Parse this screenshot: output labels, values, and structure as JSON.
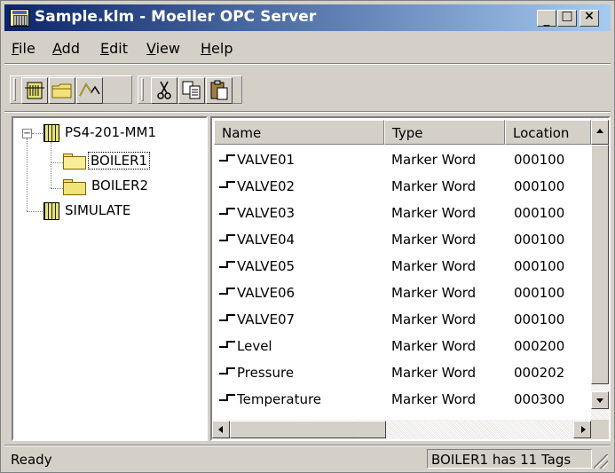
{
  "window": {
    "title": "Sample.klm - Moeller OPC Server",
    "controls": {
      "minimize": "_",
      "maximize": "□",
      "close": "×"
    }
  },
  "menu": [
    {
      "label": "File",
      "key": "F",
      "rest": "ile"
    },
    {
      "label": "Add",
      "key": "A",
      "rest": "dd"
    },
    {
      "label": "Edit",
      "key": "E",
      "rest": "dit"
    },
    {
      "label": "View",
      "key": "V",
      "rest": "iew"
    },
    {
      "label": "Help",
      "key": "H",
      "rest": "elp"
    }
  ],
  "toolbar": {
    "buttons": [
      "new-device-icon",
      "new-group-icon",
      "new-tag-icon",
      "cut-icon",
      "copy-icon",
      "paste-icon"
    ]
  },
  "tree": {
    "root": {
      "label": "PS4-201-MM1",
      "expanded": true
    },
    "groups": [
      {
        "label": "BOILER1",
        "selected": true
      },
      {
        "label": "BOILER2",
        "selected": false
      }
    ],
    "other": {
      "label": "SIMULATE"
    }
  },
  "list": {
    "columns": [
      "Name",
      "Type",
      "Location"
    ],
    "rows": [
      {
        "name": "VALVE01",
        "type": "Marker Word",
        "location": "000100"
      },
      {
        "name": "VALVE02",
        "type": "Marker Word",
        "location": "000100"
      },
      {
        "name": "VALVE03",
        "type": "Marker Word",
        "location": "000100"
      },
      {
        "name": "VALVE04",
        "type": "Marker Word",
        "location": "000100"
      },
      {
        "name": "VALVE05",
        "type": "Marker Word",
        "location": "000100"
      },
      {
        "name": "VALVE06",
        "type": "Marker Word",
        "location": "000100"
      },
      {
        "name": "VALVE07",
        "type": "Marker Word",
        "location": "000100"
      },
      {
        "name": "Level",
        "type": "Marker Word",
        "location": "000200"
      },
      {
        "name": "Pressure",
        "type": "Marker Word",
        "location": "000202"
      },
      {
        "name": "Temperature",
        "type": "Marker Word",
        "location": "000300"
      }
    ]
  },
  "status": {
    "left": "Ready",
    "right": "BOILER1 has 11 Tags"
  }
}
